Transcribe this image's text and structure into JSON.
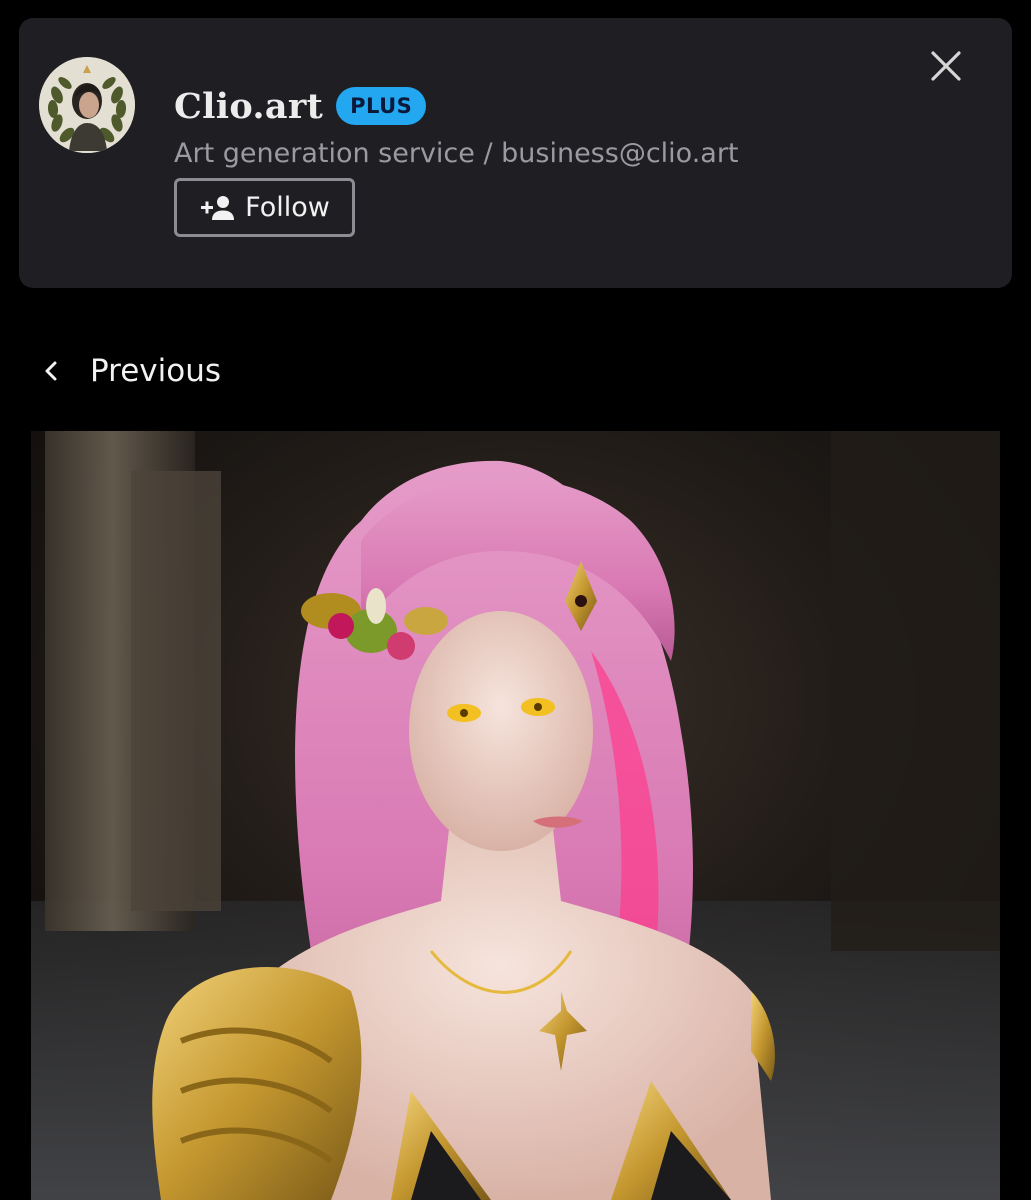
{
  "profile": {
    "name": "Clio.art",
    "badge": "PLUS",
    "description": "Art generation service / business@clio.art",
    "follow_label": "Follow",
    "avatar_icon": "laurel-portrait-avatar",
    "follow_icon": "person-add-icon",
    "close_icon": "close-icon"
  },
  "navigation": {
    "previous_label": "Previous",
    "previous_icon": "chevron-left-icon"
  },
  "artwork": {
    "subject": "pink-haired-woman-golden-armor-painting"
  },
  "colors": {
    "background": "#000000",
    "card": "#1f1f23",
    "badge": "#22a7f0",
    "subtitle": "#9a9aa0",
    "follow_border": "#8c8c92"
  }
}
